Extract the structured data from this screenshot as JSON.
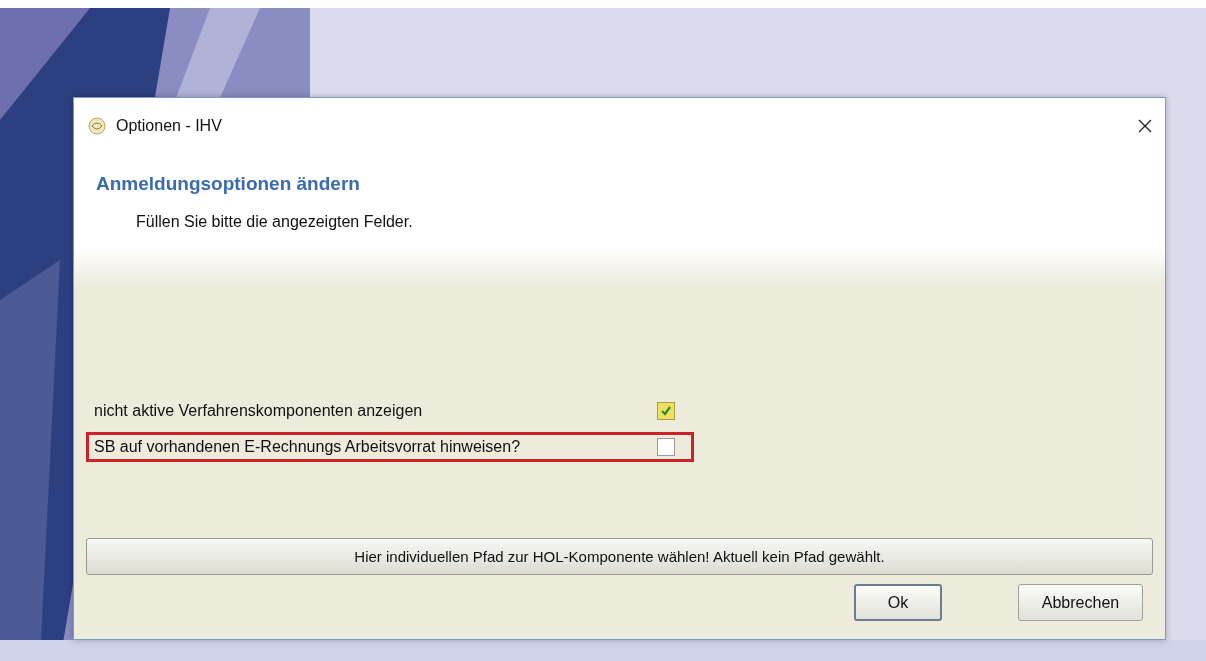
{
  "window": {
    "title": "Optionen - IHV"
  },
  "header": {
    "title": "Anmeldungsoptionen ändern",
    "subtitle": "Füllen Sie bitte die angezeigten Felder."
  },
  "options": [
    {
      "label": "nicht aktive Verfahrenskomponenten anzeigen",
      "checked": true,
      "highlighted": false
    },
    {
      "label": "SB auf vorhandenen E-Rechnungs Arbeitsvorrat hinweisen?",
      "checked": false,
      "highlighted": true
    }
  ],
  "path_button": "Hier individuellen Pfad zur HOL-Komponente wählen! Aktuell kein Pfad gewählt.",
  "buttons": [
    {
      "label": "Ok",
      "default": true
    },
    {
      "label": "Abbrechen",
      "default": false
    }
  ]
}
